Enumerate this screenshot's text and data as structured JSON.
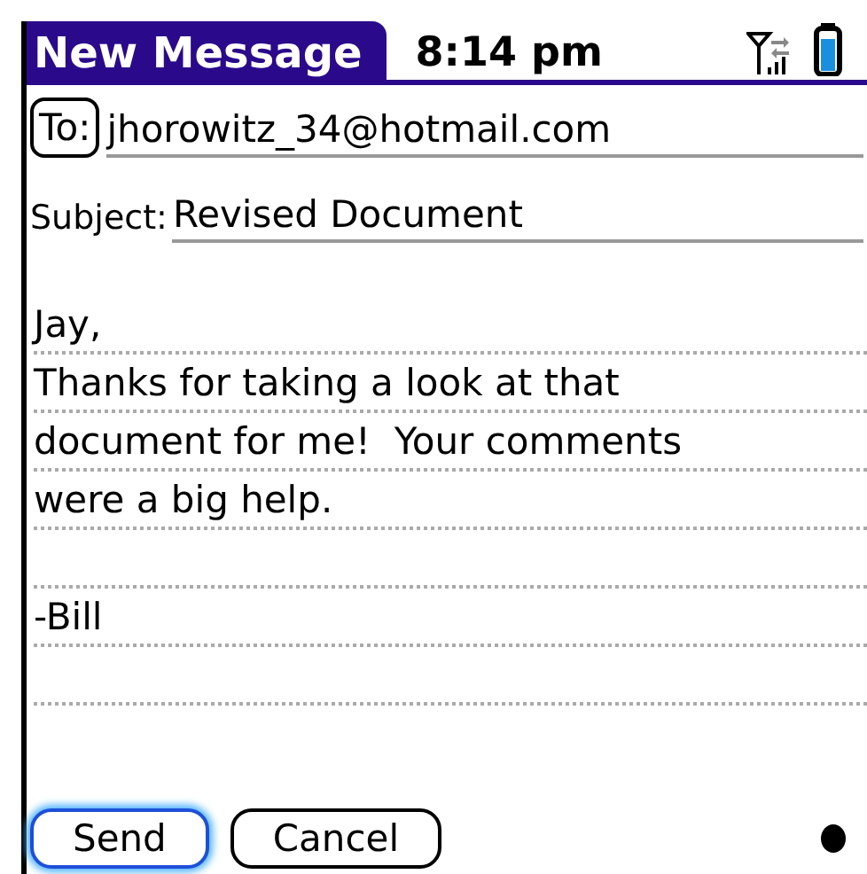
{
  "header": {
    "title": "New Message",
    "time": "8:14 pm"
  },
  "to": {
    "label": "To:",
    "value": "jhorowitz_34@hotmail.com"
  },
  "subject": {
    "label": "Subject:",
    "value": "Revised Document"
  },
  "body": {
    "value": "Jay,\nThanks for taking a look at that\ndocument for me!  Your comments\nwere a big help.\n\n-Bill"
  },
  "buttons": [
    {
      "label": "Send",
      "selected": true
    },
    {
      "label": "Cancel",
      "selected": false
    }
  ]
}
